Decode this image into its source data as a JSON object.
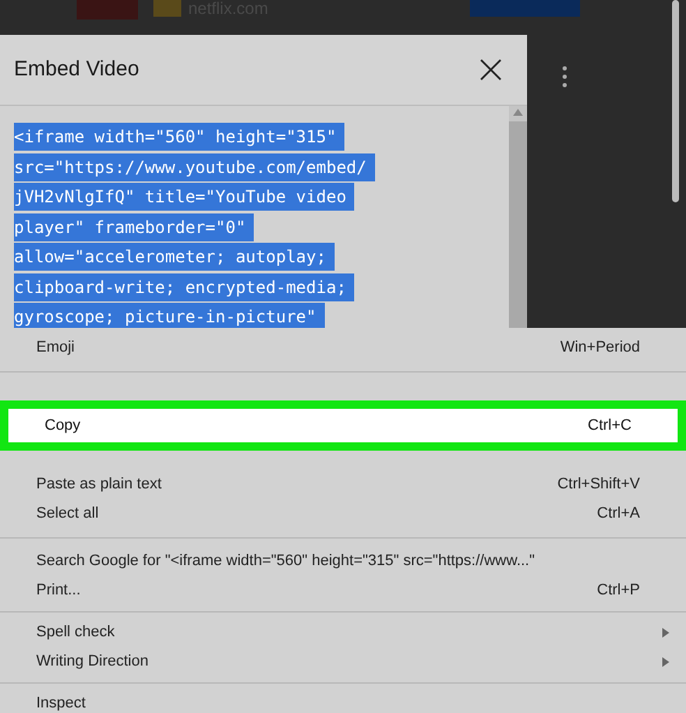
{
  "background": {
    "site": "netflix.com"
  },
  "dialog": {
    "title": "Embed Video",
    "code_lines": [
      "<iframe width=\"560\" height=\"315\"",
      "src=\"https://www.youtube.com/embed/",
      "jVH2vNlgIfQ\" title=\"YouTube video",
      "player\" frameborder=\"0\"",
      "allow=\"accelerometer; autoplay;",
      "clipboard-write; encrypted-media;",
      "gyroscope; picture-in-picture\""
    ],
    "selected": true
  },
  "context_menu": {
    "groups": [
      [
        {
          "label": "Emoji",
          "shortcut": "Win+Period",
          "selected": false
        }
      ],
      [
        {
          "kind": "hidden"
        },
        {
          "label": "Copy",
          "shortcut": "Ctrl+C",
          "selected": true
        },
        {
          "kind": "hidden"
        },
        {
          "label": "Paste as plain text",
          "shortcut": "Ctrl+Shift+V",
          "selected": false
        },
        {
          "label": "Select all",
          "shortcut": "Ctrl+A",
          "selected": false
        }
      ],
      [
        {
          "label": "Search Google for \"<iframe width=\"560\" height=\"315\" src=\"https://www...\"",
          "selected": false
        },
        {
          "label": "Print...",
          "shortcut": "Ctrl+P",
          "selected": false
        }
      ],
      [
        {
          "label": "Spell check",
          "submenu": true,
          "selected": false
        },
        {
          "label": "Writing Direction",
          "submenu": true,
          "selected": false
        }
      ],
      [
        {
          "label": "Inspect",
          "selected": false
        }
      ]
    ]
  }
}
